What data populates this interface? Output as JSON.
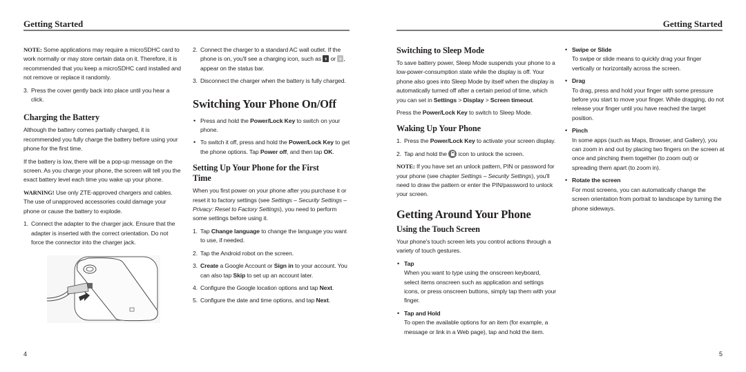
{
  "left_page": {
    "header": "Getting Started",
    "page_number": "4",
    "col1": {
      "note_label": "NOTE:",
      "note_text": " Some applications may require a microSDHC card to work normally or may store certain data on it. Therefore, it is recommended that you keep a microSDHC card installed and not remove or replace it randomly.",
      "step3_num": "3.",
      "step3_text": "Press the cover gently back into place until you hear a click.",
      "charging_heading": "Charging the Battery",
      "charging_p1": "Although the battery comes partially charged, it is recommended you fully charge the battery before using your phone for the first time.",
      "charging_p2": "If the battery is low, there will be a pop-up message on the screen. As you charge your phone, the screen will tell you the exact battery level each time you wake up your phone.",
      "warning_label": "WARNING!",
      "warning_text": " Use only ZTE-approved chargers and cables. The use of unapproved accessories could damage your phone or cause the battery to explode.",
      "step1_num": "1.",
      "step1_text": "Connect the adapter to the charger jack. Ensure that the adapter is inserted with the correct orientation. Do not force the connector into the charger jack.",
      "illustration": "phone-charging-illustration"
    },
    "col2": {
      "step2_num": "2.",
      "step2_a": "Connect the charger to a standard AC wall outlet. If the phone is on, you'll see a charging icon, such as ",
      "step2_or": " or ",
      "step2_b": ", appear on the status bar.",
      "step3_num": "3.",
      "step3_text": "Disconnect the charger when the battery is fully charged.",
      "onoff_heading": "Switching Your Phone On/Off",
      "b1_a": "Press and hold the ",
      "b1_bold": "Power/Lock Key",
      "b1_b": " to switch on your phone.",
      "b2_a": "To switch it off, press and hold the ",
      "b2_bold1": "Power/Lock Key",
      "b2_b": " to get the phone options. Tap ",
      "b2_bold2": "Power off",
      "b2_c": ", and then tap ",
      "b2_bold3": "OK",
      "b2_d": ".",
      "setup_heading": "Setting Up Your Phone for the First Time",
      "setup_p_a": "When you first power on your phone after you purchase it or reset it to factory settings (see ",
      "setup_p_i": "Settings – Security Settings – Privacy: Reset to Factory Settings",
      "setup_p_b": "), you need to perform some settings before using it.",
      "s1_num": "1.",
      "s1_a": "Tap ",
      "s1_bold": "Change language",
      "s1_b": " to change the language you want to use, if needed.",
      "s2_num": "2.",
      "s2_text": "Tap the Android robot on the screen.",
      "s3_num": "3.",
      "s3_bold1": "Create",
      "s3_a": " a Google Account or ",
      "s3_bold2": "Sign in",
      "s3_b": " to your account. You can also tap ",
      "s3_bold3": "Skip",
      "s3_c": " to set up an account later.",
      "s4_num": "4.",
      "s4_a": "Configure the Google location options and tap ",
      "s4_bold": "Next",
      "s4_b": ".",
      "s5_num": "5.",
      "s5_a": "Configure the date and time options, and tap ",
      "s5_bold": "Next",
      "s5_b": "."
    }
  },
  "right_page": {
    "header": "Getting Started",
    "page_number": "5",
    "col1": {
      "sleep_heading": "Switching to Sleep Mode",
      "sleep_p_a": "To save battery power, Sleep Mode suspends your phone to a low-power-consumption state while the display is off. Your phone also goes into Sleep Mode by itself when the display is automatically turned off after a certain period of time, which you can set in ",
      "sleep_bold1": "Settings",
      "sleep_sep1": " > ",
      "sleep_bold2": "Display",
      "sleep_sep2": " > ",
      "sleep_bold3": "Screen timeout",
      "sleep_end": ".",
      "sleep_p2_a": "Press the ",
      "sleep_p2_bold": "Power/Lock Key",
      "sleep_p2_b": " to switch to Sleep Mode.",
      "wake_heading": "Waking Up Your Phone",
      "w1_num": "1.",
      "w1_a": "Press the ",
      "w1_bold": "Power/Lock Key",
      "w1_b": " to activate your screen display.",
      "w2_num": "2.",
      "w2_a": "Tap and hold the ",
      "w2_b": " icon to unlock the screen.",
      "note_label": "NOTE:",
      "note_a": " If you have set an unlock pattern, PIN or password for your phone (see chapter ",
      "note_i": "Settings – Security Settings",
      "note_b": "), you'll need to draw the pattern or enter the PIN/password to unlock your screen.",
      "around_heading": "Getting Around Your Phone",
      "touch_heading": "Using the Touch Screen",
      "touch_p": "Your phone's touch screen lets you control actions through a variety of touch gestures.",
      "tap_title": "Tap",
      "tap_text": "When you want to type using the onscreen keyboard, select items onscreen such as application and settings icons, or press onscreen buttons, simply tap them with your finger.",
      "taphold_title": "Tap and Hold",
      "taphold_text": "To open the available options for an item (for example, a message or link in a Web page), tap and hold the item."
    },
    "col2": {
      "swipe_title": "Swipe or Slide",
      "swipe_text": "To swipe or slide means to quickly drag your finger vertically or horizontally across the screen.",
      "drag_title": "Drag",
      "drag_text": "To drag, press and hold your finger with some pressure before you start to move your finger. While dragging, do not release your finger until you have reached the target position.",
      "pinch_title": "Pinch",
      "pinch_text": "In some apps (such as Maps, Browser, and Gallery), you can zoom in and out by placing two fingers on the screen at once and pinching them together (to zoom out) or spreading them apart (to zoom in).",
      "rotate_title": "Rotate the screen",
      "rotate_text": "For most screens, you can automatically change the screen orientation from portrait to landscape by turning the phone sideways."
    },
    "bullet": "•"
  }
}
